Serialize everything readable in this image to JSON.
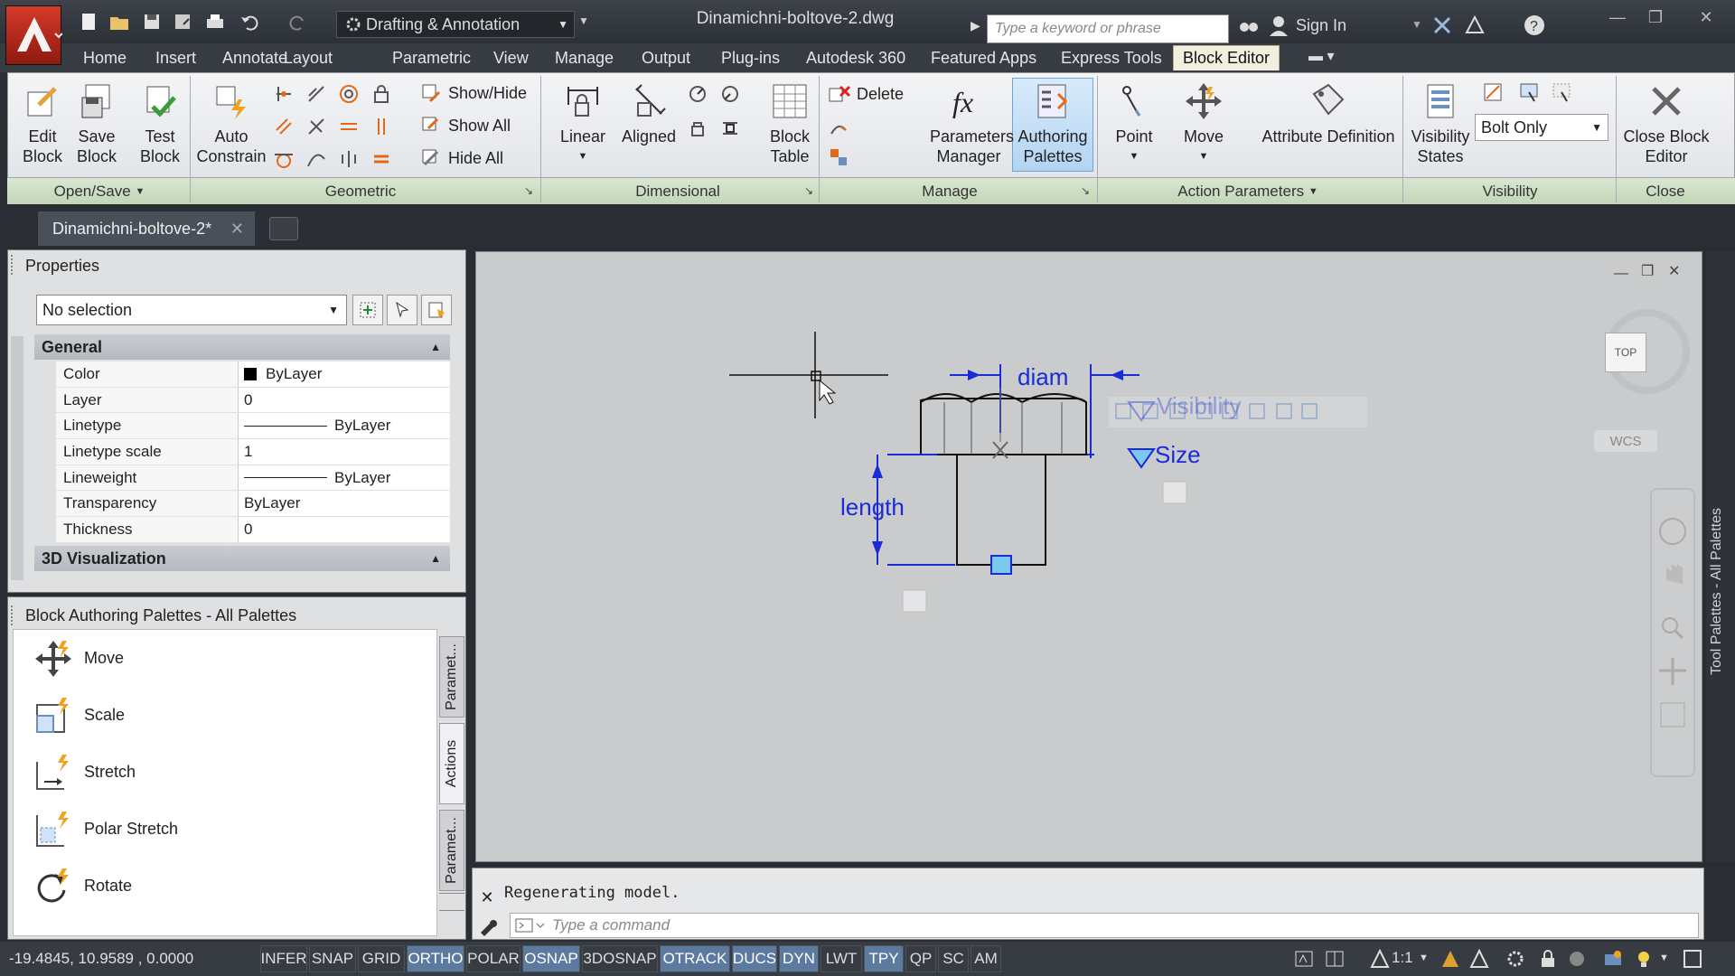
{
  "app": {
    "workspace": "Drafting & Annotation",
    "filename": "Dinamichni-boltove-2.dwg",
    "search_placeholder": "Type a keyword or phrase",
    "signin": "Sign In"
  },
  "menu_tabs": [
    "Home",
    "Insert",
    "Annotate",
    "Layout",
    "Parametric",
    "View",
    "Manage",
    "Output",
    "Plug-ins",
    "Autodesk 360",
    "Featured Apps",
    "Express Tools",
    "Block Editor"
  ],
  "active_tab": "Block Editor",
  "ribbon": {
    "open_save": {
      "title": "Open/Save",
      "edit_block": "Edit Block",
      "save_block": "Save Block",
      "test_block": "Test Block"
    },
    "geometric": {
      "title": "Geometric",
      "auto_constrain": "Auto Constrain",
      "show_hide": "Show/Hide",
      "show_all": "Show All",
      "hide_all": "Hide All"
    },
    "dimensional": {
      "title": "Dimensional",
      "linear": "Linear",
      "aligned": "Aligned",
      "block_table": "Block Table"
    },
    "manage": {
      "title": "Manage",
      "delete": "Delete",
      "parameters_manager": "Parameters Manager",
      "authoring_palettes": "Authoring Palettes"
    },
    "action_parameters": {
      "title": "Action Parameters",
      "point": "Point",
      "move": "Move",
      "attribute_definition": "Attribute Definition"
    },
    "visibility": {
      "title": "Visibility",
      "visibility_states": "Visibility States",
      "state_value": "Bolt Only"
    },
    "close": {
      "title": "Close",
      "close_block_editor": "Close Block Editor"
    }
  },
  "doc_tab": "Dinamichni-boltove-2*",
  "properties": {
    "title": "Properties",
    "selection": "No selection",
    "general": "General",
    "rows": [
      {
        "key": "Color",
        "value": "ByLayer"
      },
      {
        "key": "Layer",
        "value": "0"
      },
      {
        "key": "Linetype",
        "value": "ByLayer"
      },
      {
        "key": "Linetype scale",
        "value": "1"
      },
      {
        "key": "Lineweight",
        "value": "ByLayer"
      },
      {
        "key": "Transparency",
        "value": "ByLayer"
      },
      {
        "key": "Thickness",
        "value": "0"
      }
    ],
    "viz3d": "3D Visualization"
  },
  "palettes": {
    "title": "Block Authoring Palettes - All Palettes",
    "items": [
      "Move",
      "Scale",
      "Stretch",
      "Polar Stretch",
      "Rotate"
    ],
    "side_tabs": [
      "Paramet...",
      "Actions",
      "Paramet..."
    ]
  },
  "drawing": {
    "diam": "diam",
    "length": "length",
    "visibility": "Visibility",
    "size": "Size",
    "viewcube_top": "TOP",
    "wcs": "WCS",
    "tool_palettes": "Tool Palettes - All Palettes"
  },
  "command": {
    "output": "Regenerating model.",
    "placeholder": "Type a command"
  },
  "status": {
    "coords": "-19.4845, 10.9589 , 0.0000",
    "toggles": [
      {
        "label": "INFER",
        "on": false
      },
      {
        "label": "SNAP",
        "on": false
      },
      {
        "label": "GRID",
        "on": false
      },
      {
        "label": "ORTHO",
        "on": true
      },
      {
        "label": "POLAR",
        "on": false
      },
      {
        "label": "OSNAP",
        "on": true
      },
      {
        "label": "3DOSNAP",
        "on": false
      },
      {
        "label": "OTRACK",
        "on": true
      },
      {
        "label": "DUCS",
        "on": true
      },
      {
        "label": "DYN",
        "on": true
      },
      {
        "label": "LWT",
        "on": false
      },
      {
        "label": "TPY",
        "on": true
      },
      {
        "label": "QP",
        "on": false
      },
      {
        "label": "SC",
        "on": false
      },
      {
        "label": "AM",
        "on": false
      }
    ],
    "scale": "1:1"
  },
  "colors": {
    "param_blue": "#1a2bd8",
    "ribbon_active": "#f1efde",
    "status_on": "#5c7aa0"
  }
}
